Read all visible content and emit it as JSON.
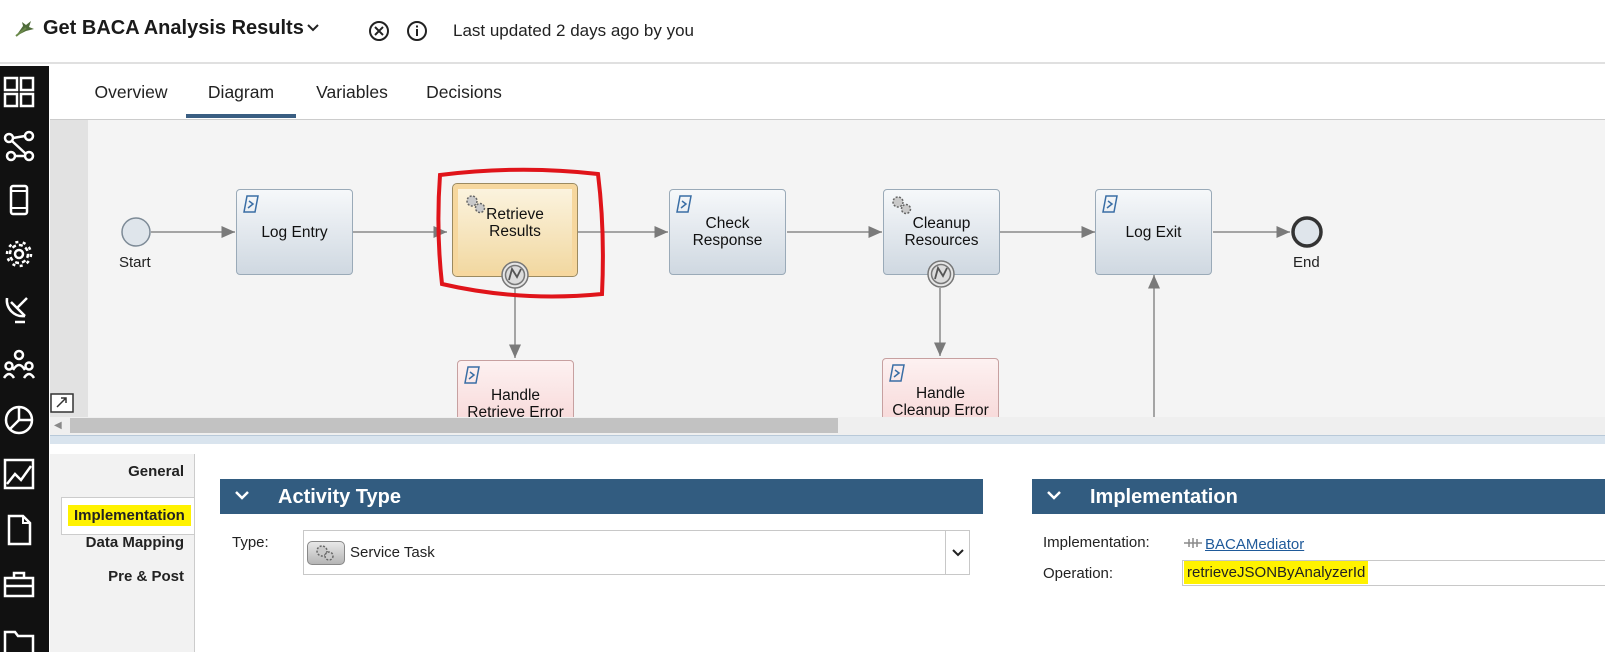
{
  "header": {
    "title": "Get BACA Analysis Results",
    "last_updated": "Last updated 2 days ago by you"
  },
  "sidebar": {
    "items": [
      "dashboard-icon",
      "process-flow-icon",
      "mobile-icon",
      "settings-gear-icon",
      "satellite-dish-icon",
      "team-icon",
      "pie-chart-icon",
      "trend-chart-icon",
      "document-icon",
      "toolbox-icon"
    ]
  },
  "tabs": [
    {
      "label": "Overview",
      "active": false
    },
    {
      "label": "Diagram",
      "active": true
    },
    {
      "label": "Variables",
      "active": false
    },
    {
      "label": "Decisions",
      "active": false
    }
  ],
  "diagram": {
    "start_label": "Start",
    "end_label": "End",
    "nodes": {
      "log_entry": "Log Entry",
      "retrieve_results": [
        "Retrieve",
        "Results"
      ],
      "check_response": [
        "Check",
        "Response"
      ],
      "cleanup_resources": [
        "Cleanup",
        "Resources"
      ],
      "log_exit": "Log Exit",
      "handle_retrieve_error": [
        "Handle",
        "Retrieve Error"
      ],
      "handle_cleanup_error": [
        "Handle",
        "Cleanup Error"
      ]
    },
    "highlight_color": "#e0141a"
  },
  "properties": {
    "nav": [
      "General",
      "Implementation",
      "Data Mapping",
      "Pre & Post"
    ],
    "activity_type": {
      "title": "Activity Type",
      "type_label": "Type:",
      "type_value": "Service Task"
    },
    "implementation": {
      "title": "Implementation",
      "impl_label": "Implementation:",
      "impl_value": "BACAMediator",
      "operation_label": "Operation:",
      "operation_value": "retrieveJSONByAnalyzerId"
    }
  },
  "colors": {
    "panel_header": "#325c80",
    "active_tab_underline": "#3a5e82",
    "highlighter": "#fff200"
  }
}
